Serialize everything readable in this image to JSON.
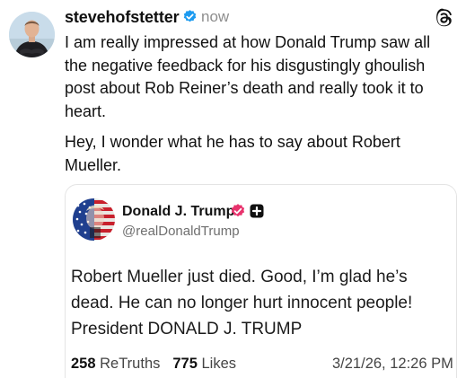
{
  "post": {
    "username": "stevehofstetter",
    "time": "now",
    "paragraph1": "I am really impressed at how Donald Trump saw all\nthe negative feedback for his disgustingly ghoulish\npost about Rob Reiner’s death and really took it to\nheart.",
    "paragraph2": "Hey, I wonder what he has to say about Robert\nMueller.",
    "icons": [
      "verified-badge-icon",
      "threads-logo-icon"
    ],
    "colors": {
      "verified": "#1d9bf0"
    }
  },
  "quote": {
    "name": "Donald J. Trump",
    "handle": "@realDonaldTrump",
    "text": "Robert Mueller just died. Good, I’m glad he’s\ndead. He can no longer hurt innocent people!\nPresident DONALD J. TRUMP",
    "retruths_count": "258",
    "retruths_label": "ReTruths",
    "likes_count": "775",
    "likes_label": "Likes",
    "date": "3/21/26, 12:26 PM",
    "icons": [
      "verified-badge-icon",
      "plus-badge-icon"
    ],
    "colors": {
      "verified": "#e8336d",
      "plus_badge": "#111111"
    }
  }
}
